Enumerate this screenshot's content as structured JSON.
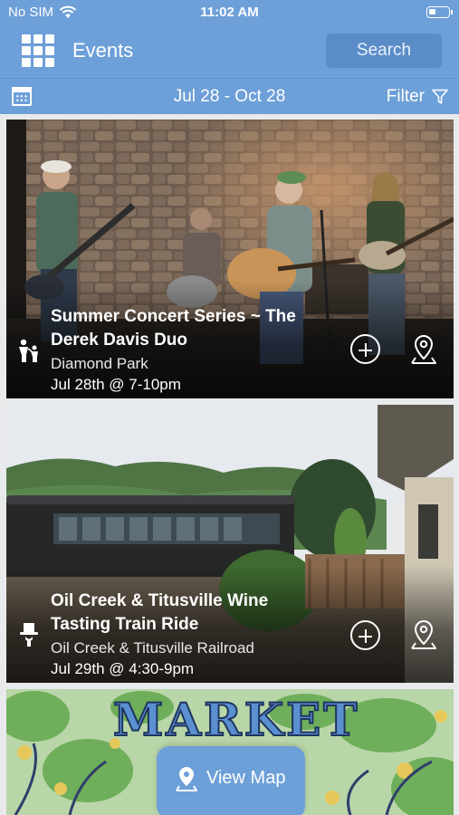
{
  "status_bar": {
    "carrier": "No SIM",
    "time": "11:02 AM"
  },
  "nav": {
    "title": "Events",
    "search_label": "Search",
    "menu_icon": "grid-menu-icon"
  },
  "date_bar": {
    "range": "Jul 28  -  Oct 28",
    "filter_label": "Filter"
  },
  "events": [
    {
      "title_line1": "Summer Concert Series ~ The",
      "title_line2": "Derek Davis Duo",
      "venue": "Diamond Park",
      "time": "Jul 28th @ 7-10pm",
      "category_icon": "family-icon"
    },
    {
      "title_line1": "Oil Creek & Titusville Wine",
      "title_line2": "Tasting Train Ride",
      "venue": "Oil Creek & Titusville Railroad",
      "time": "Jul 29th @ 4:30-9pm",
      "category_icon": "top-hat-icon"
    },
    {
      "poster_text": "MARKET"
    }
  ],
  "map_button": {
    "label": "View Map"
  },
  "colors": {
    "accent": "#6d9fd8",
    "button": "#5a8cc8"
  }
}
